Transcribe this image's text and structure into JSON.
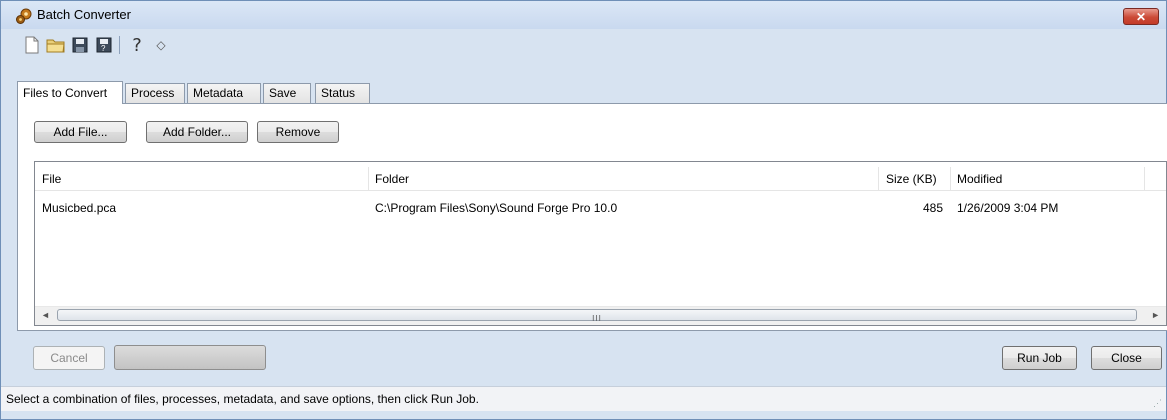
{
  "window": {
    "title": "Batch Converter",
    "close_label": "✕"
  },
  "toolbar": {
    "icons": [
      "new-document-icon",
      "open-folder-icon",
      "save-icon",
      "save-as-icon",
      "help-icon",
      "about-icon"
    ],
    "help_glyph": "?",
    "about_glyph": "◇"
  },
  "tabs": [
    {
      "label": "Files to Convert",
      "active": true
    },
    {
      "label": "Process",
      "active": false
    },
    {
      "label": "Metadata",
      "active": false
    },
    {
      "label": "Save",
      "active": false
    },
    {
      "label": "Status",
      "active": false
    }
  ],
  "files_panel": {
    "add_file_label": "Add File...",
    "add_folder_label": "Add Folder...",
    "remove_label": "Remove",
    "columns": [
      "File",
      "Folder",
      "Size (KB)",
      "Modified"
    ],
    "rows": [
      {
        "file": "Musicbed.pca",
        "folder": "C:\\Program Files\\Sony\\Sound Forge Pro 10.0",
        "size": "485",
        "modified": "1/26/2009 3:04 PM"
      }
    ],
    "scroll_left_glyph": "◄",
    "scroll_right_glyph": "►",
    "scroll_grip": "III"
  },
  "footer": {
    "cancel_label": "Cancel",
    "run_job_label": "Run Job",
    "close_label": "Close",
    "status_text": "Select a combination of files, processes, metadata, and save options, then click Run Job.",
    "resize_grip": "⋰"
  }
}
